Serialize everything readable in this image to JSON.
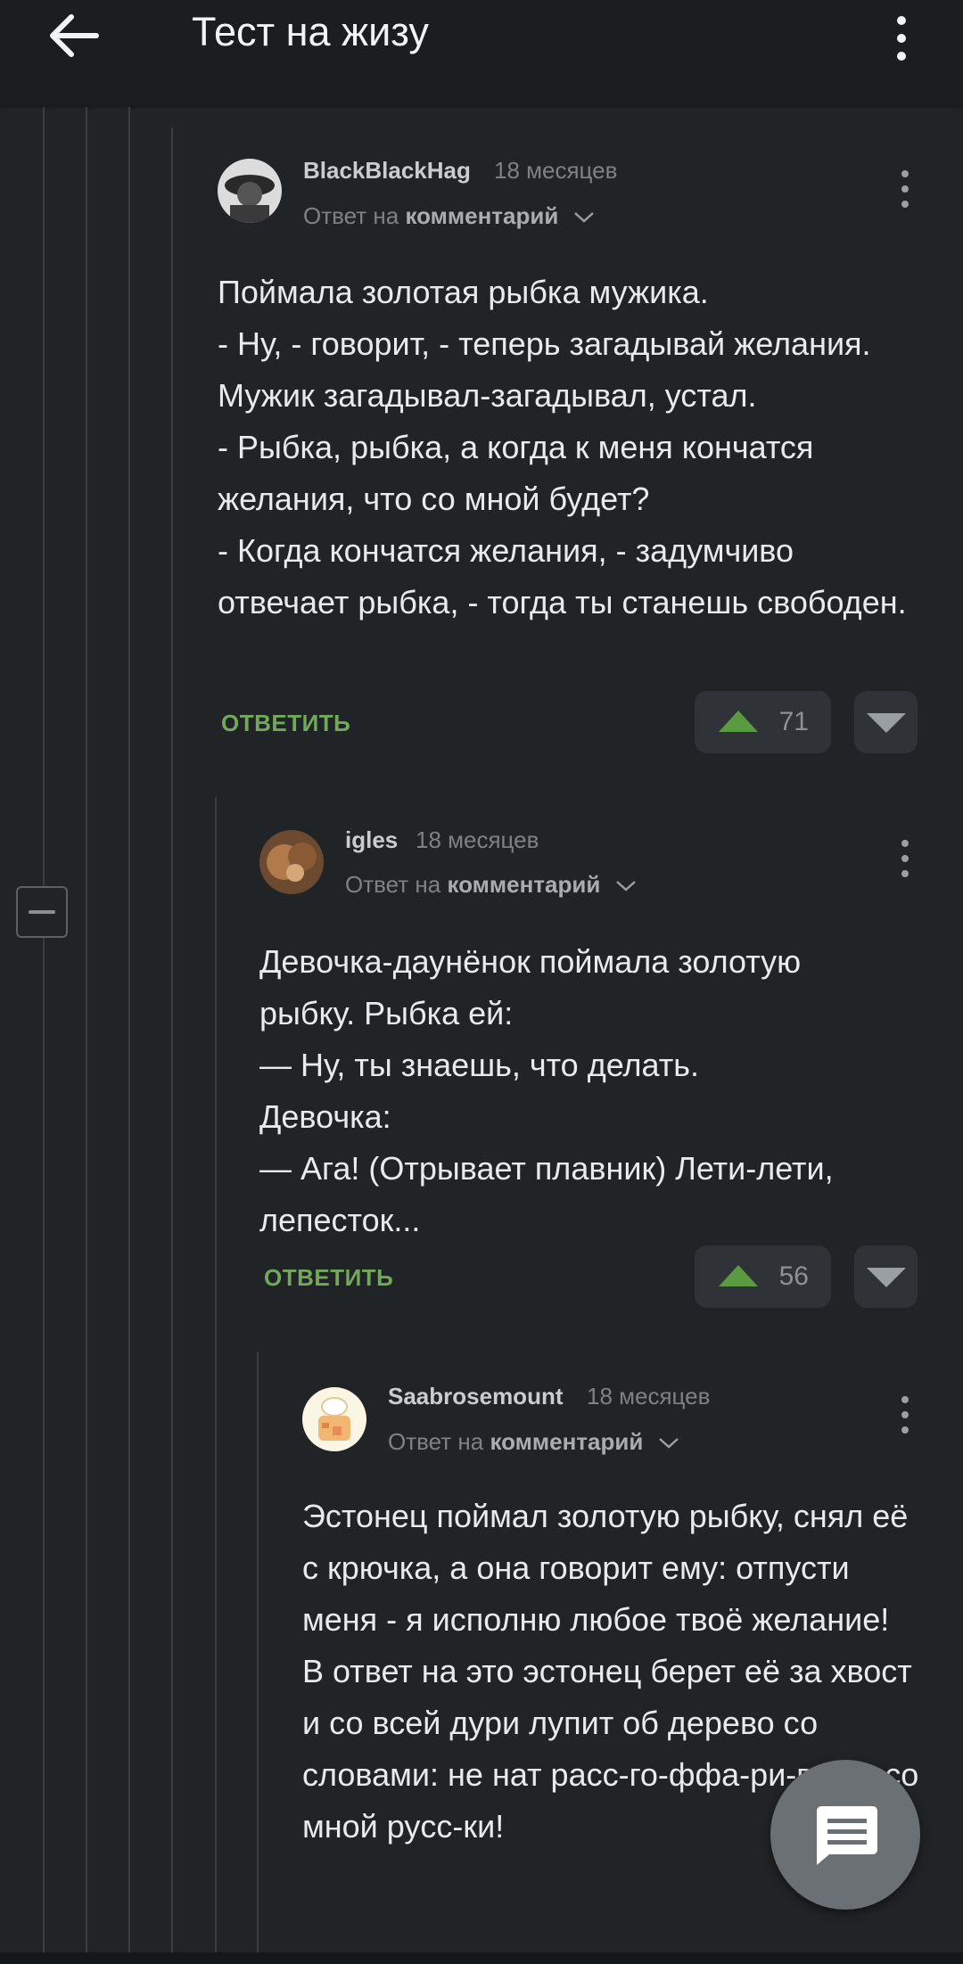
{
  "appbar": {
    "title": "Тест на жизу",
    "back_icon": "arrow-left-icon",
    "more_icon": "more-vertical-icon"
  },
  "colors": {
    "background": "#212427",
    "appbar": "#1b1e20",
    "accent_green": "#73a75a",
    "upvote": "#5a9a40"
  },
  "comments": [
    {
      "author": "BlackBlackHag",
      "age": "18 месяцев",
      "reply_prefix": "Ответ на ",
      "reply_target": "комментарий",
      "text": "Поймала золотая рыбка мужика.\n- Ну, - говорит, - теперь загадывай желания.\nМужик загадывал-загадывал, устал.\n- Рыбка, рыбка, а когда к меня кончатся желания, что со мной будет?\n- Когда кончатся желания, - задумчиво отвечает рыбка, - тогда ты станешь свободен.",
      "reply_label": "ОТВЕТИТЬ",
      "votes": "71"
    },
    {
      "author": "igles",
      "age": "18 месяцев",
      "reply_prefix": "Ответ на ",
      "reply_target": "комментарий",
      "text": "Девочка-даунёнок поймала золотую рыбку. Рыбка ей:\n— Ну, ты знаешь, что делать.\nДевочка:\n— Ага! (Отрывает плавник) Лети-лети, лепесток...",
      "reply_label": "ОТВЕТИТЬ",
      "votes": "56"
    },
    {
      "author": "Saabrosemount",
      "age": "18 месяцев",
      "reply_prefix": "Ответ на ",
      "reply_target": "комментарий",
      "text": "Эстонец поймал золотую рыбку, снял её с крючка, а она говорит ему: отпусти меня - я исполню любое твоё желание!\nВ ответ на это эстонец берет её за хвост и со всей дури лупит об дерево со словами: не нат расс-го-ффа-ри-ватт сcо мной руcc-ки!"
    }
  ]
}
